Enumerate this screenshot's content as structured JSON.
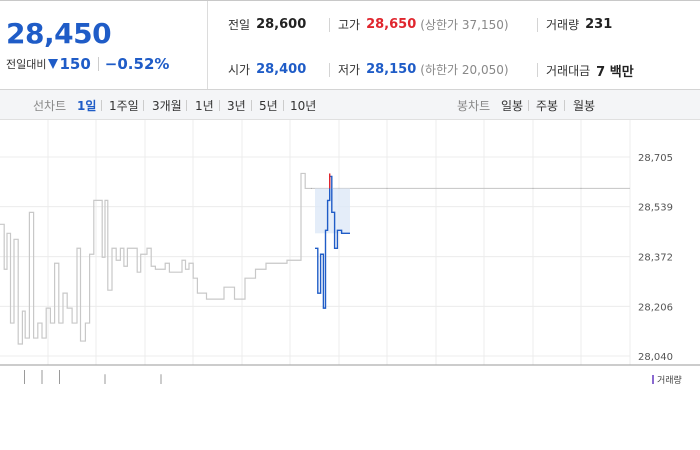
{
  "quote": {
    "price": "28,450",
    "change_label": "전일대비",
    "change_abs": "150",
    "change_pct": "−0.52%",
    "prev_label": "전일",
    "prev": "28,600",
    "open_label": "시가",
    "open": "28,400",
    "high_label": "고가",
    "high": "28,650",
    "upper_limit": "(상한가 37,150)",
    "low_label": "저가",
    "low": "28,150",
    "lower_limit": "(하한가 20,050)",
    "volume_label": "거래량",
    "volume": "231",
    "amount_label": "거래대금",
    "amount": "7 백만"
  },
  "periods": {
    "line_label": "선차트",
    "line_items": [
      "1일",
      "1주일",
      "3개월",
      "1년",
      "3년",
      "5년",
      "10년"
    ],
    "active": "1일",
    "candle_label": "봉차트",
    "candle_items": [
      "일봉",
      "주봉",
      "월봉"
    ]
  },
  "colors": {
    "up": "#e0262e",
    "down": "#1f5cc7",
    "history": "#c8c8c8",
    "grid": "#ececec"
  },
  "chart_data": {
    "type": "line",
    "title": "",
    "xlabel": "",
    "ylabel": "",
    "y_ticks": [
      "28,705",
      "28,539",
      "28,372",
      "28,206",
      "28,040"
    ],
    "y_tick_values": [
      28705,
      28539,
      28372,
      28206,
      28040
    ],
    "ylim": [
      28040,
      28705
    ],
    "x_range": [
      0,
      100
    ],
    "grid": true,
    "volume_label": "거래량",
    "reference_line": 28600,
    "series": [
      {
        "role": "history",
        "points": [
          [
            0,
            28480
          ],
          [
            0.6,
            28330
          ],
          [
            1,
            28450
          ],
          [
            1.5,
            28150
          ],
          [
            2,
            28430
          ],
          [
            2.6,
            28080
          ],
          [
            3.2,
            28190
          ],
          [
            3.6,
            28100
          ],
          [
            4.2,
            28520
          ],
          [
            4.8,
            28100
          ],
          [
            5.4,
            28150
          ],
          [
            6,
            28100
          ],
          [
            6.6,
            28200
          ],
          [
            7.2,
            28150
          ],
          [
            7.8,
            28350
          ],
          [
            8.4,
            28150
          ],
          [
            9,
            28250
          ],
          [
            9.6,
            28200
          ],
          [
            10.3,
            28150
          ],
          [
            11,
            28400
          ],
          [
            11.5,
            28090
          ],
          [
            12.2,
            28150
          ],
          [
            12.8,
            28380
          ],
          [
            13.4,
            28560
          ],
          [
            14,
            28560
          ],
          [
            14.6,
            28370
          ],
          [
            15,
            28560
          ],
          [
            15.4,
            28260
          ],
          [
            16,
            28400
          ],
          [
            16.6,
            28360
          ],
          [
            17.2,
            28400
          ],
          [
            17.7,
            28340
          ],
          [
            18.2,
            28400
          ],
          [
            19,
            28400
          ],
          [
            19.6,
            28320
          ],
          [
            20.1,
            28380
          ],
          [
            21,
            28400
          ],
          [
            21.6,
            28340
          ],
          [
            22.2,
            28330
          ],
          [
            23,
            28330
          ],
          [
            23.6,
            28350
          ],
          [
            24.2,
            28320
          ],
          [
            25.5,
            28320
          ],
          [
            26,
            28360
          ],
          [
            26.5,
            28330
          ],
          [
            27,
            28350
          ],
          [
            27.6,
            28300
          ],
          [
            28.2,
            28250
          ],
          [
            29,
            28250
          ],
          [
            29.5,
            28230
          ],
          [
            31.5,
            28230
          ],
          [
            32,
            28270
          ],
          [
            33,
            28270
          ],
          [
            33.5,
            28230
          ],
          [
            34.5,
            28230
          ],
          [
            35,
            28300
          ],
          [
            36,
            28300
          ],
          [
            36.5,
            28330
          ],
          [
            37.5,
            28330
          ],
          [
            38,
            28350
          ],
          [
            40,
            28350
          ],
          [
            41,
            28360
          ],
          [
            42.5,
            28360
          ],
          [
            43,
            28650
          ],
          [
            43.6,
            28600
          ],
          [
            44.5,
            28600
          ]
        ],
        "color": "#c8c8c8"
      },
      {
        "role": "today",
        "points": [
          [
            45,
            28400
          ],
          [
            45.4,
            28250
          ],
          [
            45.8,
            28380
          ],
          [
            46.2,
            28200
          ],
          [
            46.5,
            28460
          ],
          [
            46.8,
            28560
          ],
          [
            47.1,
            28640
          ],
          [
            47.4,
            28520
          ],
          [
            47.8,
            28400
          ],
          [
            48.2,
            28460
          ],
          [
            48.8,
            28450
          ],
          [
            49.2,
            28450
          ],
          [
            50,
            28450
          ]
        ],
        "color": "#1f5cc7"
      }
    ],
    "highlight_range": [
      45,
      50
    ],
    "volume_bars": [
      {
        "x": 3.5,
        "v": 1
      },
      {
        "x": 6,
        "v": 1
      },
      {
        "x": 8.5,
        "v": 1
      },
      {
        "x": 15,
        "v": 0.7
      },
      {
        "x": 23,
        "v": 0.7
      }
    ]
  }
}
